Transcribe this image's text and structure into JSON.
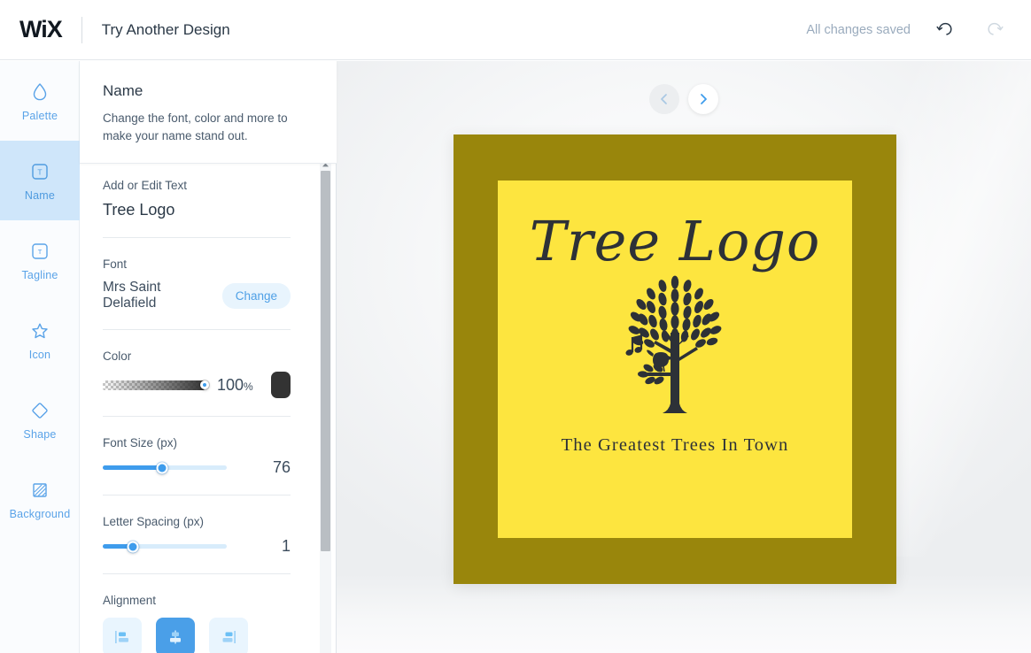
{
  "header": {
    "logo_text": "WiX",
    "title": "Try Another Design",
    "status": "All changes saved",
    "undo_icon": "undo-icon",
    "redo_icon": "redo-icon"
  },
  "sidebar": {
    "items": [
      {
        "label": "Palette",
        "icon": "droplet-icon",
        "active": false
      },
      {
        "label": "Name",
        "icon": "text-box-icon",
        "active": true
      },
      {
        "label": "Tagline",
        "icon": "text-box-icon",
        "active": false
      },
      {
        "label": "Icon",
        "icon": "star-icon",
        "active": false
      },
      {
        "label": "Shape",
        "icon": "diamond-icon",
        "active": false
      },
      {
        "label": "Background",
        "icon": "hatched-square-icon",
        "active": false
      }
    ]
  },
  "panel": {
    "title": "Name",
    "description": "Change the font, color and more to make your name stand out.",
    "text_field": {
      "label": "Add or Edit Text",
      "value": "Tree Logo"
    },
    "font": {
      "label": "Font",
      "value": "Mrs Saint Delafield",
      "change_label": "Change"
    },
    "color": {
      "label": "Color",
      "opacity": "100",
      "opacity_unit": "%",
      "swatch_hex": "#333333",
      "slider_percent": 100
    },
    "font_size": {
      "label": "Font Size (px)",
      "value": "76",
      "slider_percent": 48
    },
    "letter_spacing": {
      "label": "Letter Spacing (px)",
      "value": "1",
      "slider_percent": 24
    },
    "alignment": {
      "label": "Alignment",
      "options": [
        {
          "name": "align-left",
          "active": false
        },
        {
          "name": "align-center",
          "active": true
        },
        {
          "name": "align-right",
          "active": false
        }
      ]
    }
  },
  "canvas": {
    "prev_icon": "chevron-left-icon",
    "next_icon": "chevron-right-icon",
    "logo": {
      "name": "Tree Logo",
      "tagline": "The Greatest Trees In Town",
      "border_hex": "#99860C",
      "background_hex": "#FDE53F",
      "ink_hex": "#2D3137",
      "icon": "tree-with-bird-icon"
    }
  },
  "colors": {
    "accent_blue": "#3E9CEC",
    "rail_active": "#CFE6FA",
    "text_dark": "#2B3947",
    "text_muted": "#9AABBD"
  }
}
